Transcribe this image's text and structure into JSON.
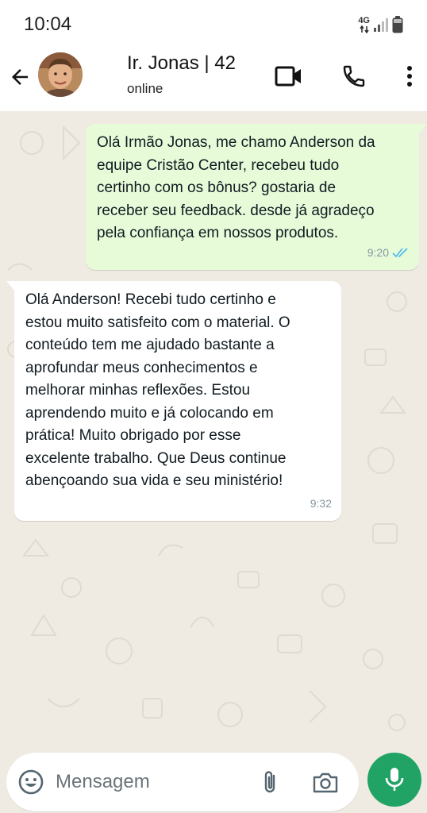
{
  "status_bar": {
    "time": "10:04",
    "network": "4G"
  },
  "header": {
    "contact_name": "Ir. Jonas | 42",
    "contact_status": "online",
    "icons": [
      "back-arrow-icon",
      "video-call-icon",
      "phone-icon",
      "more-vert-icon"
    ]
  },
  "messages": [
    {
      "direction": "outgoing",
      "lines": [
        "Olá Irmão Jonas, me chamo Anderson da",
        "equipe Cristão Center, recebeu tudo",
        "certinho com os bônus? gostaria de",
        "receber seu feedback. desde já agradeço",
        "pela confiança em nossos produtos."
      ],
      "time": "9:20",
      "read_receipt": "double-check-blue-icon"
    },
    {
      "direction": "incoming",
      "lines": [
        "Olá Anderson! Recebi tudo certinho e",
        "estou muito satisfeito com o material. O",
        "conteúdo tem me ajudado bastante a",
        "aprofundar meus conhecimentos e",
        "melhorar minhas reflexões. Estou",
        "aprendendo muito e já colocando em",
        "prática! Muito obrigado por esse",
        "excelente trabalho. Que Deus continue",
        "abençoando sua vida e seu ministério!"
      ],
      "time": "9:32"
    }
  ],
  "composer": {
    "placeholder": "Mensagem",
    "value": ""
  },
  "colors": {
    "outgoing_bubble": "#e7fbd9",
    "incoming_bubble": "#ffffff",
    "chat_background": "#efeae2",
    "mic_button": "#21a366",
    "read_tick": "#53bdeb",
    "meta_text": "#8696a0"
  }
}
